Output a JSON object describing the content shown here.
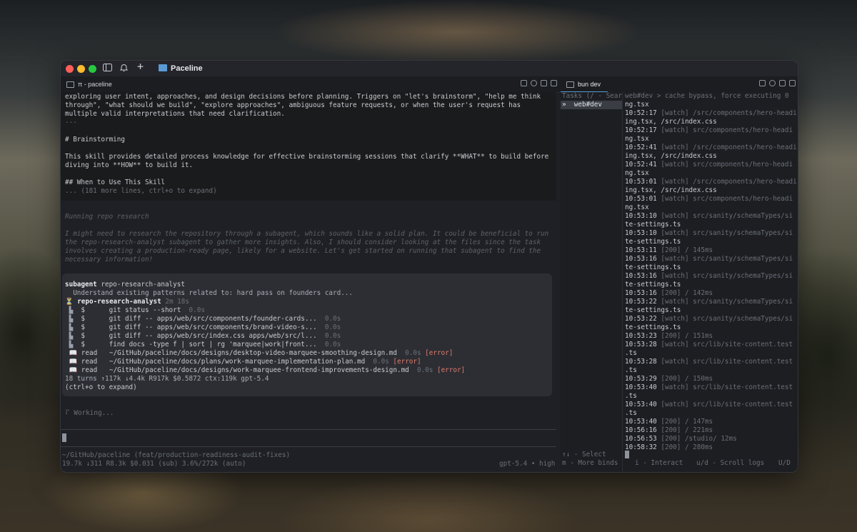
{
  "window": {
    "title": "Paceline"
  },
  "tabs": {
    "left": {
      "label": "π - paceline"
    },
    "right": {
      "label": "bun dev"
    }
  },
  "left_pane": {
    "doc_lines": [
      "exploring user intent, approaches, and design decisions before planning. Triggers on \"let's brainstorm\", \"help me think",
      "through\", \"what should we build\", \"explore approaches\", ambiguous feature requests, or when the user's request has",
      "multiple valid interpretations that need clarification.",
      "---",
      "",
      "# Brainstorming",
      "",
      "This skill provides detailed process knowledge for effective brainstorming sessions that clarify **WHAT** to build before",
      "diving into **HOW** to build it.",
      "",
      "## When to Use This Skill"
    ],
    "more_lines": "... (181 more lines, ctrl+o to expand)",
    "running_title": "Running repo research",
    "thinking_lines": [
      "I might need to research the repository through a subagent, which sounds like a solid plan. It could be beneficial to run",
      "the repo-research-analyst subagent to gather more insights. Also, I should consider looking at the files since the task",
      "involves creating a production-ready page, likely for a website. Let's get started on running that subagent to find the",
      "necessary information!"
    ],
    "subagent": {
      "keyword": "subagent",
      "name": "repo-research-analyst",
      "task": "  Understand existing patterns related to: hard pass on founders card...",
      "status_name": "repo-research-analyst",
      "status_time": "2m 18s",
      "steps": [
        {
          "kind": "$",
          "text": "git status --short",
          "dur": "0.0s",
          "err": ""
        },
        {
          "kind": "$",
          "text": "git diff -- apps/web/src/components/founder-cards...",
          "dur": "0.0s",
          "err": ""
        },
        {
          "kind": "$",
          "text": "git diff -- apps/web/src/components/brand-video-s...",
          "dur": "0.0s",
          "err": ""
        },
        {
          "kind": "$",
          "text": "git diff -- apps/web/src/index.css apps/web/src/l...",
          "dur": "0.0s",
          "err": ""
        },
        {
          "kind": "$",
          "text": "find docs -type f | sort | rg 'marquee|work|front...",
          "dur": "0.0s",
          "err": ""
        },
        {
          "kind": "read",
          "text": "~/GitHub/paceline/docs/designs/desktop-video-marquee-smoothing-design.md",
          "dur": "0.0s",
          "err": "[error]"
        },
        {
          "kind": "read",
          "text": "~/GitHub/paceline/docs/plans/work-marquee-implementation-plan.md",
          "dur": "0.0s",
          "err": "[error]"
        },
        {
          "kind": "read",
          "text": "~/GitHub/paceline/docs/designs/work-marquee-frontend-improvements-design.md",
          "dur": "0.0s",
          "err": "[error]"
        }
      ],
      "summary": "18 turns ↑117k ↓4.4k R917k $0.5872 ctx:119k gpt-5.4",
      "expand": "(ctrl+o to expand)"
    },
    "working": "⠏ Working...",
    "footer_path": "~/GitHub/paceline (feat/production-readiness-audit-fixes)",
    "footer_stats": "19.7k ↓311 R8.3k $0.031 (sub) 3.6%/272k (auto)",
    "footer_model": "gpt-5.4 • high"
  },
  "right_pane": {
    "tasks_header": "Tasks (/ - Sear",
    "task_item": "»  web#dev",
    "select_hint": "↑↓ - Select",
    "more_binds": "m - More binds",
    "interact_hint": "i - Interact",
    "scroll_hint": "u/d - Scroll logs",
    "extra_hint": "U/D",
    "log_lines": [
      {
        "a": "web#dev > cache bypass, force executing 0",
        "b": ""
      },
      {
        "a": "ng.tsx",
        "b": ""
      },
      {
        "a": "10:52:17 ",
        "b": "[watch] /src/components/hero-headi"
      },
      {
        "a": "ing.tsx, /src/index.css",
        "b": ""
      },
      {
        "a": "10:52:17 ",
        "b": "[watch] src/components/hero-headi"
      },
      {
        "a": "ng.tsx",
        "b": ""
      },
      {
        "a": "10:52:41 ",
        "b": "[watch] /src/components/hero-headi"
      },
      {
        "a": "ing.tsx, /src/index.css",
        "b": ""
      },
      {
        "a": "10:52:41 ",
        "b": "[watch] src/components/hero-headi"
      },
      {
        "a": "ng.tsx",
        "b": ""
      },
      {
        "a": "10:53:01 ",
        "b": "[watch] /src/components/hero-headi"
      },
      {
        "a": "ing.tsx, /src/index.css",
        "b": ""
      },
      {
        "a": "10:53:01 ",
        "b": "[watch] src/components/hero-headi"
      },
      {
        "a": "ng.tsx",
        "b": ""
      },
      {
        "a": "10:53:10 ",
        "b": "[watch] src/sanity/schemaTypes/si"
      },
      {
        "a": "te-settings.ts",
        "b": ""
      },
      {
        "a": "10:53:10 ",
        "b": "[watch] src/sanity/schemaTypes/si"
      },
      {
        "a": "te-settings.ts",
        "b": ""
      },
      {
        "a": "10:53:11 ",
        "b": "[200] / 145ms"
      },
      {
        "a": "10:53:16 ",
        "b": "[watch] src/sanity/schemaTypes/si"
      },
      {
        "a": "te-settings.ts",
        "b": ""
      },
      {
        "a": "10:53:16 ",
        "b": "[watch] src/sanity/schemaTypes/si"
      },
      {
        "a": "te-settings.ts",
        "b": ""
      },
      {
        "a": "10:53:16 ",
        "b": "[200] / 142ms"
      },
      {
        "a": "10:53:22 ",
        "b": "[watch] src/sanity/schemaTypes/si"
      },
      {
        "a": "te-settings.ts",
        "b": ""
      },
      {
        "a": "10:53:22 ",
        "b": "[watch] src/sanity/schemaTypes/si"
      },
      {
        "a": "te-settings.ts",
        "b": ""
      },
      {
        "a": "10:53:23 ",
        "b": "[200] / 151ms"
      },
      {
        "a": "10:53:28 ",
        "b": "[watch] src/lib/site-content.test"
      },
      {
        "a": ".ts",
        "b": ""
      },
      {
        "a": "10:53:28 ",
        "b": "[watch] src/lib/site-content.test"
      },
      {
        "a": ".ts",
        "b": ""
      },
      {
        "a": "10:53:29 ",
        "b": "[200] / 150ms"
      },
      {
        "a": "10:53:40 ",
        "b": "[watch] src/lib/site-content.test"
      },
      {
        "a": ".ts",
        "b": ""
      },
      {
        "a": "10:53:40 ",
        "b": "[watch] src/lib/site-content.test"
      },
      {
        "a": ".ts",
        "b": ""
      },
      {
        "a": "10:53:40 ",
        "b": "[200] / 147ms"
      },
      {
        "a": "10:56:16 ",
        "b": "[200] / 221ms"
      },
      {
        "a": "10:56:53 ",
        "b": "[200] /studio/ 12ms"
      },
      {
        "a": "10:58:32 ",
        "b": "[200] / 280ms"
      }
    ]
  },
  "colors": {
    "close": "#ff5f57",
    "minimize": "#febc2e",
    "zoom": "#28c840",
    "accent": "#5b9bd5",
    "error": "#e07b6c"
  }
}
